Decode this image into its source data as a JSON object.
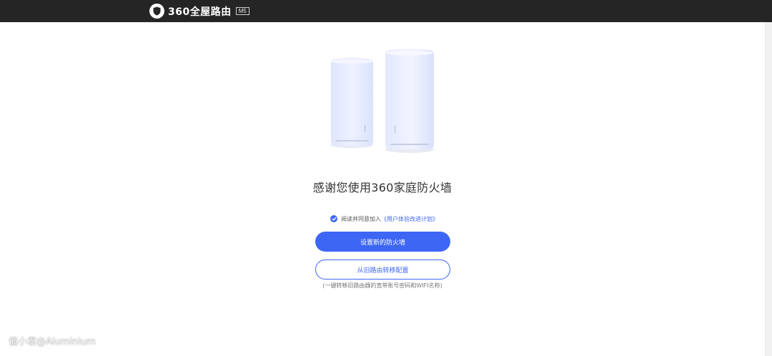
{
  "header": {
    "brand_name": "360全屋路由",
    "model_badge": "M5",
    "logo_icon": "shield-logo-icon"
  },
  "main": {
    "title": "感谢您使用360家庭防火墙",
    "agreement": {
      "checked": true,
      "prefix": "阅读并同意加入",
      "link_text": "《用户体验改进计划》"
    },
    "primary_button": "设置新的防火墙",
    "secondary_button": "从旧路由转移配置",
    "hint": "(一键转移旧路由器的宽带账号密码和WIFI名称)"
  },
  "watermark": "值小君@Aluminium",
  "colors": {
    "accent": "#3d66f5",
    "header_bg": "#252525",
    "router_body": "#e6ebff"
  }
}
